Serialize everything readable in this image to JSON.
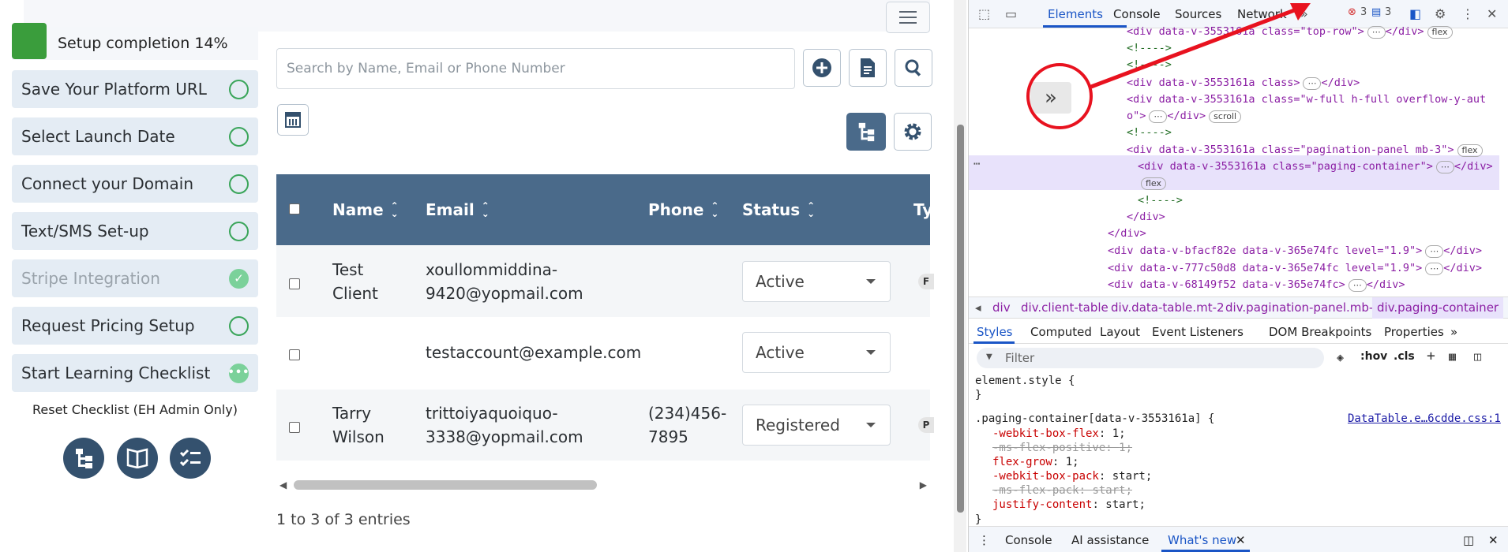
{
  "setup": {
    "title": "Setup completion 14%",
    "items": [
      {
        "label": "Save Your Platform URL",
        "state": "open"
      },
      {
        "label": "Select Launch Date",
        "state": "open"
      },
      {
        "label": "Connect your Domain",
        "state": "open"
      },
      {
        "label": "Text/SMS Set-up",
        "state": "open"
      },
      {
        "label": "Stripe Integration",
        "state": "done"
      },
      {
        "label": "Request Pricing Setup",
        "state": "open"
      },
      {
        "label": "Start Learning Checklist",
        "state": "in-progress"
      }
    ],
    "reset_link": "Reset Checklist (EH Admin Only)",
    "completion_percent": 14
  },
  "search": {
    "placeholder": "Search by Name, Email or Phone Number"
  },
  "table": {
    "headers": {
      "name": "Name",
      "email": "Email",
      "phone": "Phone",
      "status": "Status",
      "type": "Ty"
    },
    "rows": [
      {
        "name_line1": "Test",
        "name_line2": "Client",
        "email_line1": "xoullommiddina-",
        "email_line2": "9420@yopmail.com",
        "phone_line1": "",
        "phone_line2": "",
        "status": "Active",
        "type": "F"
      },
      {
        "name_line1": "",
        "name_line2": "",
        "email_line1": "testaccount@example.com",
        "email_line2": "",
        "phone_line1": "",
        "phone_line2": "",
        "status": "Active",
        "type": ""
      },
      {
        "name_line1": "Tarry",
        "name_line2": "Wilson",
        "email_line1": "trittoiyaquoiquo-",
        "email_line2": "3338@yopmail.com",
        "phone_line1": "(234)456-",
        "phone_line2": "7895",
        "status": "Registered",
        "type": "P"
      }
    ],
    "entries_text": "1 to 3 of 3 entries"
  },
  "devtools": {
    "tabs": [
      "Elements",
      "Console",
      "Sources",
      "Network"
    ],
    "error_count": "3",
    "message_count": "3",
    "code_lines": [
      {
        "indent": 1,
        "text": "<div data-v-3553161a class=\"top-row\">",
        "tail": "</div>",
        "pill": "flex"
      },
      {
        "indent": 1,
        "text": "<!---->",
        "tail": "",
        "pill": ""
      },
      {
        "indent": 1,
        "text": "<!---->",
        "tail": "",
        "pill": ""
      },
      {
        "indent": 1,
        "text": "<div data-v-3553161a class>",
        "tail": "</div>",
        "pill": ""
      },
      {
        "indent": 1,
        "text": "<div data-v-3553161a class=\"w-full h-full overflow-y-aut",
        "tail": "",
        "pill": ""
      },
      {
        "indent": 1,
        "text": "o\">",
        "tail": "</div>",
        "pill": "scroll"
      },
      {
        "indent": 1,
        "text": "<!---->",
        "tail": "",
        "pill": ""
      },
      {
        "indent": 1,
        "text": "<div data-v-3553161a class=\"pagination-panel mb-3\">",
        "tail": "",
        "pill": "flex"
      },
      {
        "indent": 2,
        "text": "<div data-v-3553161a class=\"paging-container\">",
        "tail": "</div>",
        "pill": ""
      },
      {
        "indent": 2,
        "text": "",
        "tail": "",
        "pill": "flex"
      },
      {
        "indent": 2,
        "text": "<!---->",
        "tail": "",
        "pill": ""
      },
      {
        "indent": 1,
        "text": "</div>",
        "tail": "",
        "pill": ""
      },
      {
        "indent": 0,
        "text": "</div>",
        "tail": "",
        "pill": ""
      },
      {
        "indent": 0,
        "text": "<div data-v-bfacf82e data-v-365e74fc level=\"1.9\">",
        "tail": "</div>",
        "pill": ""
      },
      {
        "indent": 0,
        "text": "<div data-v-777c50d8 data-v-365e74fc level=\"1.9\">",
        "tail": "</div>",
        "pill": ""
      },
      {
        "indent": 0,
        "text": "<div data-v-68149f52 data-v-365e74fc>",
        "tail": "</div>",
        "pill": ""
      }
    ],
    "breadcrumbs": [
      "div",
      "div.client-table",
      "div.data-table.mt-2",
      "div.pagination-panel.mb-3",
      "div.paging-container"
    ],
    "style_tabs": [
      "Styles",
      "Computed",
      "Layout",
      "Event Listeners",
      "DOM Breakpoints",
      "Properties"
    ],
    "filter_placeholder": "Filter",
    "hov": ":hov",
    "cls": ".cls",
    "element_style": "element.style {",
    "close_brace": "}",
    "rule_selector": ".paging-container[data-v-3553161a] {",
    "rule_source": "DataTable.e…6cdde.css:1",
    "declarations": [
      {
        "prop": "-webkit-box-flex",
        "value": "1;",
        "struck": false
      },
      {
        "prop": "-ms-flex-positive",
        "value": "1;",
        "struck": true
      },
      {
        "prop": "flex-grow",
        "value": "1;",
        "struck": false
      },
      {
        "prop": "-webkit-box-pack",
        "value": "start;",
        "struck": false
      },
      {
        "prop": "-ms-flex-pack",
        "value": "start;",
        "struck": true
      },
      {
        "prop": "justify-content",
        "value": "start;",
        "struck": false
      }
    ],
    "bottom_tabs": [
      "Console",
      "AI assistance",
      "What's new"
    ],
    "colors": {
      "accent": "#1a55c6",
      "annotation": "#e8121f"
    }
  }
}
